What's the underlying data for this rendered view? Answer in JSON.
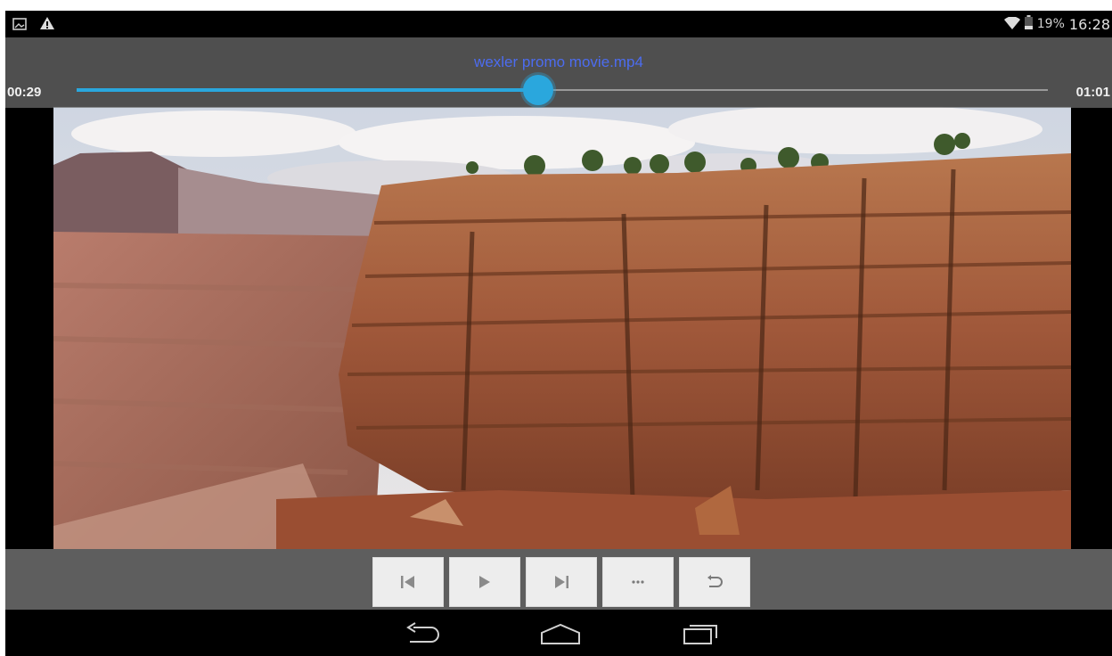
{
  "status_bar": {
    "left_icons": [
      "image-notification-icon",
      "warning-icon"
    ],
    "right_icons": [
      "wifi-icon",
      "battery-icon"
    ],
    "battery_percent": "19%",
    "clock": "16:28"
  },
  "player": {
    "title": "wexler promo movie.mp4",
    "elapsed": "00:29",
    "total": "01:01",
    "progress_fraction": 0.475,
    "accent_color": "#2aa7dd",
    "title_color": "#4c6cf0"
  },
  "controls": [
    {
      "name": "previous-button",
      "icon": "skip-previous-icon"
    },
    {
      "name": "play-button",
      "icon": "play-icon"
    },
    {
      "name": "next-button",
      "icon": "skip-next-icon"
    },
    {
      "name": "more-button",
      "icon": "more-icon"
    },
    {
      "name": "return-button",
      "icon": "return-icon"
    }
  ],
  "navigation_bar": [
    "back-icon",
    "home-icon",
    "recent-apps-icon"
  ]
}
